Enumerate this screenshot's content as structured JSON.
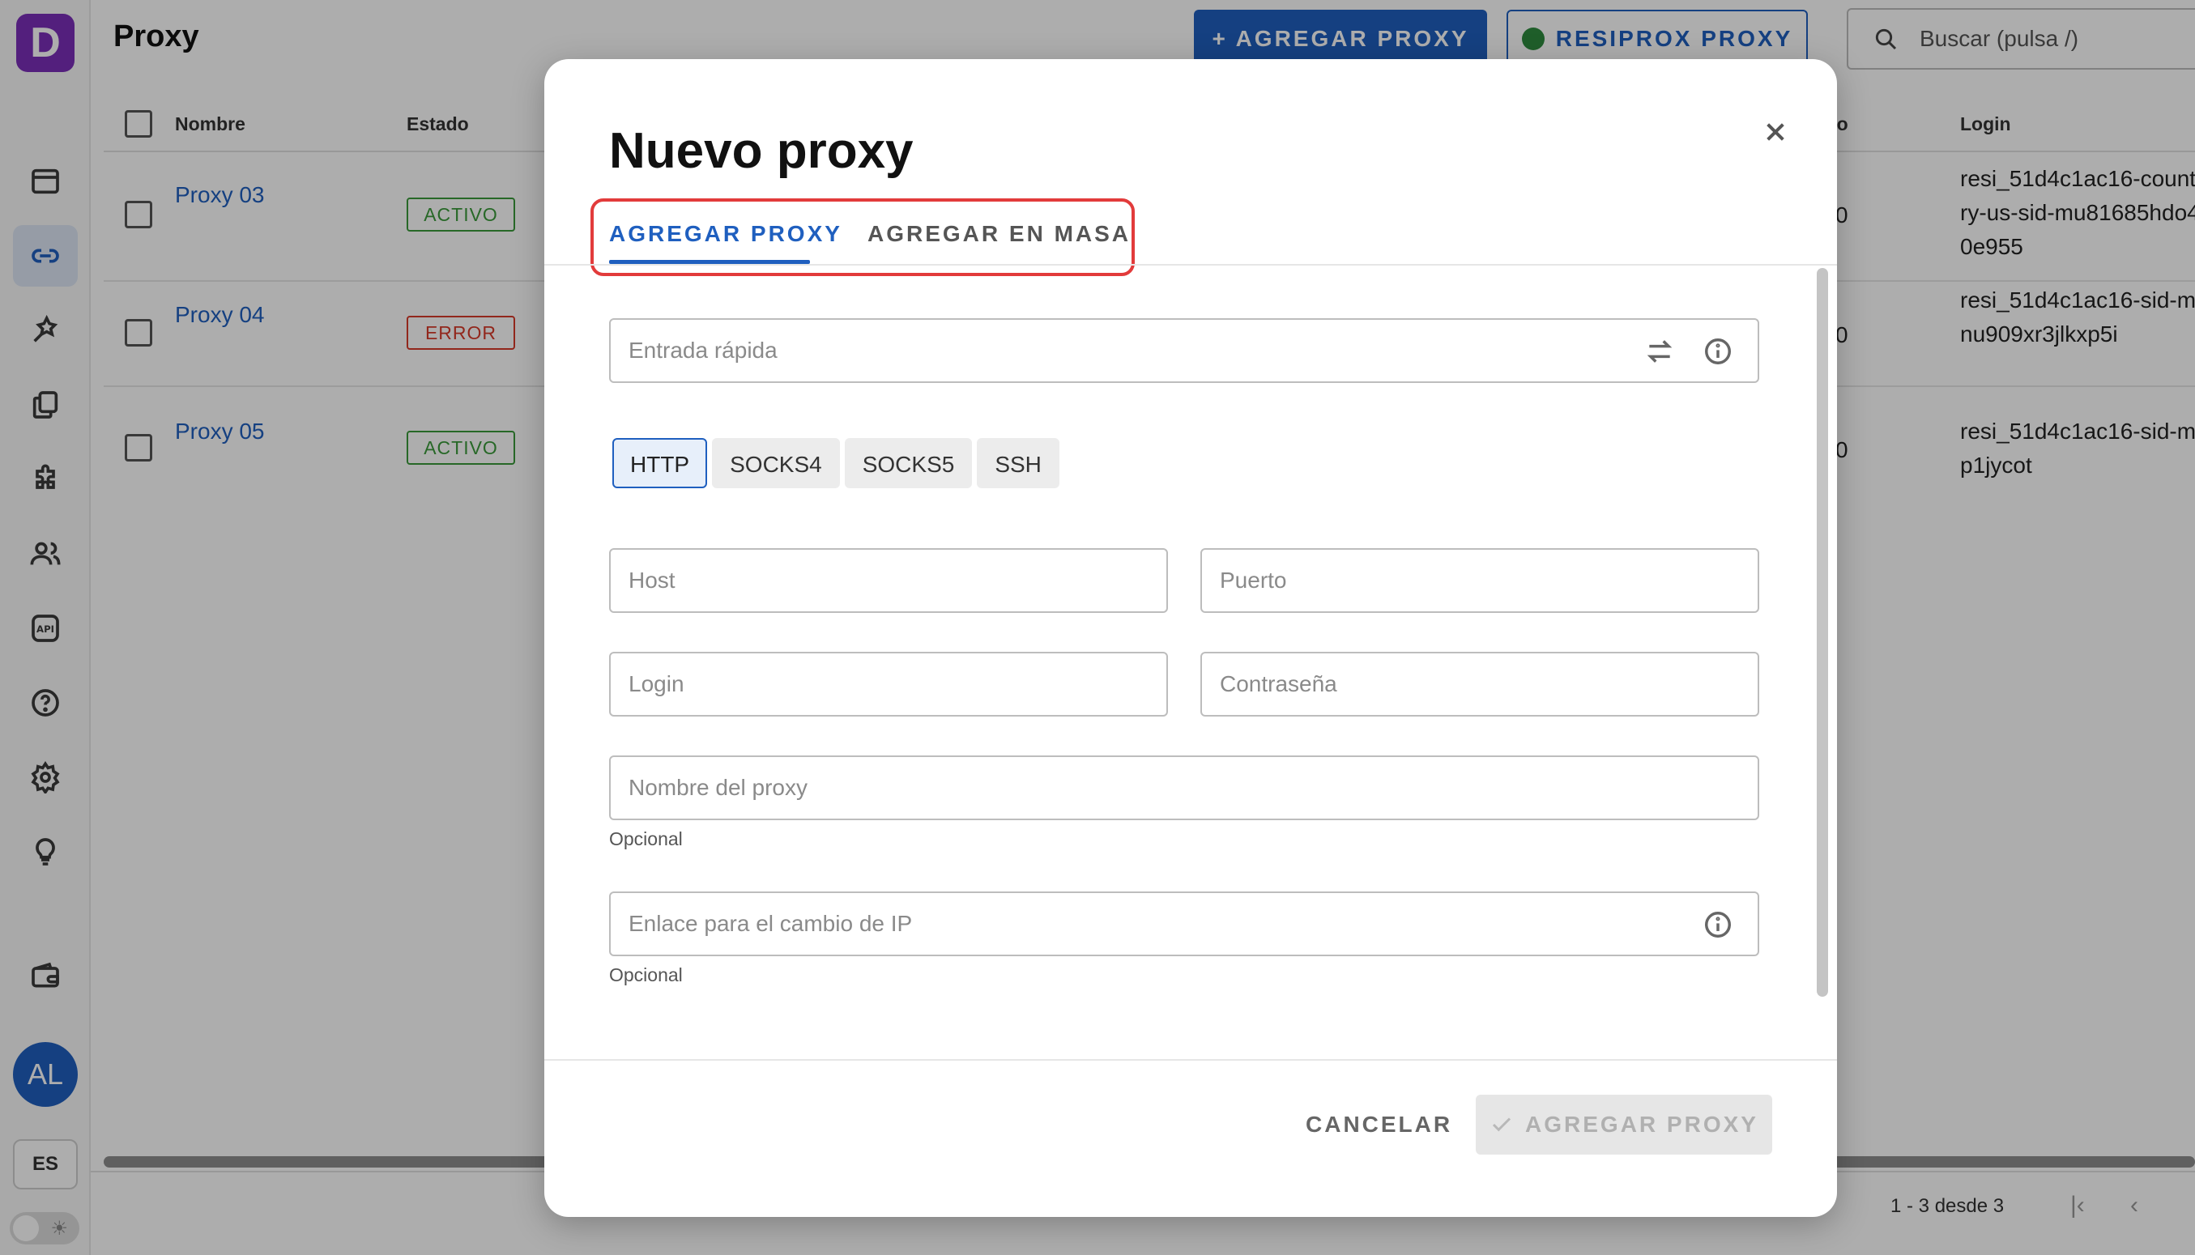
{
  "page": {
    "title": "Proxy",
    "add_button": "+ AGREGAR PROXY",
    "resiprox_button": "RESIPROX PROXY",
    "search_placeholder": "Buscar (pulsa /)"
  },
  "sidebar": {
    "logo_letter": "D",
    "icons": [
      "browser-icon",
      "link-icon",
      "automation-icon",
      "copy-icon",
      "puzzle-icon",
      "users-icon",
      "api-icon",
      "help-icon",
      "settings-icon",
      "lightbulb-icon",
      "wallet-icon"
    ],
    "active_item": "link-icon",
    "avatar_initials": "AL",
    "language": "ES"
  },
  "table": {
    "headers": {
      "name": "Nombre",
      "status": "Estado",
      "port": "to",
      "login": "Login"
    },
    "rows": [
      {
        "name": "Proxy 03",
        "status": "ACTIVO",
        "status_kind": "ok",
        "port": "0",
        "login": "resi_51d4c1ac16-country-us-sid-mu81685hdo40e955"
      },
      {
        "name": "Proxy 04",
        "status": "ERROR",
        "status_kind": "err",
        "port": "0",
        "login": "resi_51d4c1ac16-sid-mnu909xr3jlkxp5i"
      },
      {
        "name": "Proxy 05",
        "status": "ACTIVO",
        "status_kind": "ok",
        "port": "0",
        "login": "resi_51d4c1ac16-sid-mp1jycot"
      }
    ],
    "pagination": "1 - 3 desde 3"
  },
  "modal": {
    "title": "Nuevo proxy",
    "tabs": [
      {
        "label": "AGREGAR PROXY",
        "active": true
      },
      {
        "label": "AGREGAR EN MASA",
        "active": false
      }
    ],
    "quick_input_placeholder": "Entrada rápida",
    "protocols": [
      {
        "label": "HTTP",
        "selected": true
      },
      {
        "label": "SOCKS4",
        "selected": false
      },
      {
        "label": "SOCKS5",
        "selected": false
      },
      {
        "label": "SSH",
        "selected": false
      }
    ],
    "host_placeholder": "Host",
    "port_placeholder": "Puerto",
    "login_placeholder": "Login",
    "password_placeholder": "Contraseña",
    "name_placeholder": "Nombre del proxy",
    "name_hint": "Opcional",
    "ip_change_placeholder": "Enlace para el cambio de IP",
    "ip_change_hint": "Opcional",
    "cancel_label": "CANCELAR",
    "submit_label": "AGREGAR PROXY"
  },
  "colors": {
    "accent": "#1f5fbf",
    "active_status": "#3a9a3a",
    "error_status": "#d83a2a",
    "highlight_box": "#e23b3b",
    "logo": "#7b2fb8"
  }
}
